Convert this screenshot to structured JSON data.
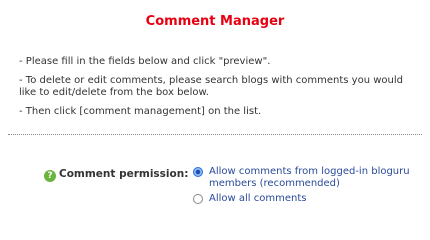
{
  "title": "Comment Manager",
  "instructions": [
    "- Please fill in the fields below and click \"preview\".",
    "- To delete or edit comments, please search blogs with comments you would like to edit/delete from the box below.",
    "- Then click [comment management] on the list."
  ],
  "permission": {
    "label": "Comment permission:",
    "help_icon": "?",
    "options": [
      {
        "label": "Allow comments from logged-in bloguru members (recommended)",
        "selected": true
      },
      {
        "label": "Allow all comments",
        "selected": false
      }
    ]
  }
}
